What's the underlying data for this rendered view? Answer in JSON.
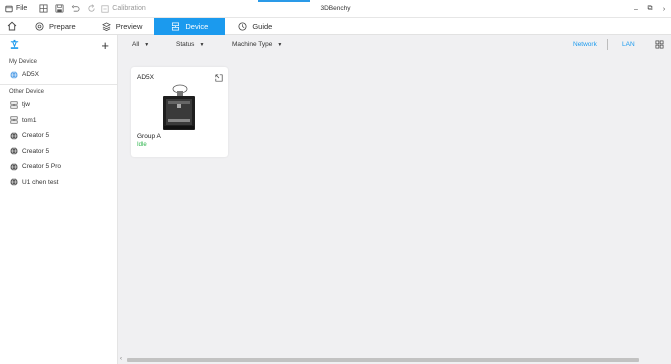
{
  "window": {
    "title": "3DBenchy"
  },
  "titlebar": {
    "file_label": "File",
    "calibration_label": "Calibration",
    "minimize_glyph": "–",
    "maximize_glyph": "⧉",
    "close_glyph": "›"
  },
  "nav": {
    "tabs": [
      {
        "label": "Prepare",
        "icon": "prepare-icon"
      },
      {
        "label": "Preview",
        "icon": "preview-icon"
      },
      {
        "label": "Device",
        "icon": "device-icon",
        "active": true
      },
      {
        "label": "Guide",
        "icon": "guide-icon"
      }
    ],
    "active_color": "#1b9aee"
  },
  "sidebar": {
    "add_glyph": "+",
    "my_device_label": "My Device",
    "my_devices": [
      {
        "label": "AD5X",
        "icon": "globe-icon"
      }
    ],
    "other_device_label": "Other Device",
    "other_devices": [
      {
        "label": "tjw",
        "icon": "lan-icon"
      },
      {
        "label": "tom1",
        "icon": "lan-icon"
      },
      {
        "label": "Creator 5",
        "icon": "globe-dark-icon"
      },
      {
        "label": "Creator 5",
        "icon": "globe-dark-icon"
      },
      {
        "label": "Creator 5 Pro",
        "icon": "globe-dark-icon"
      },
      {
        "label": "U1 chen test",
        "icon": "globe-dark-icon"
      }
    ]
  },
  "filters": {
    "all_label": "All",
    "status_label": "Status",
    "machine_type_label": "Machine Type",
    "caret_glyph": "▼",
    "network_label": "Network",
    "lan_label": "LAN"
  },
  "device_card": {
    "name": "AD5X",
    "group": "Group A",
    "status": "Idle",
    "status_color": "#2bb44a"
  },
  "scrollbar": {
    "arrow_glyph": "‹"
  }
}
